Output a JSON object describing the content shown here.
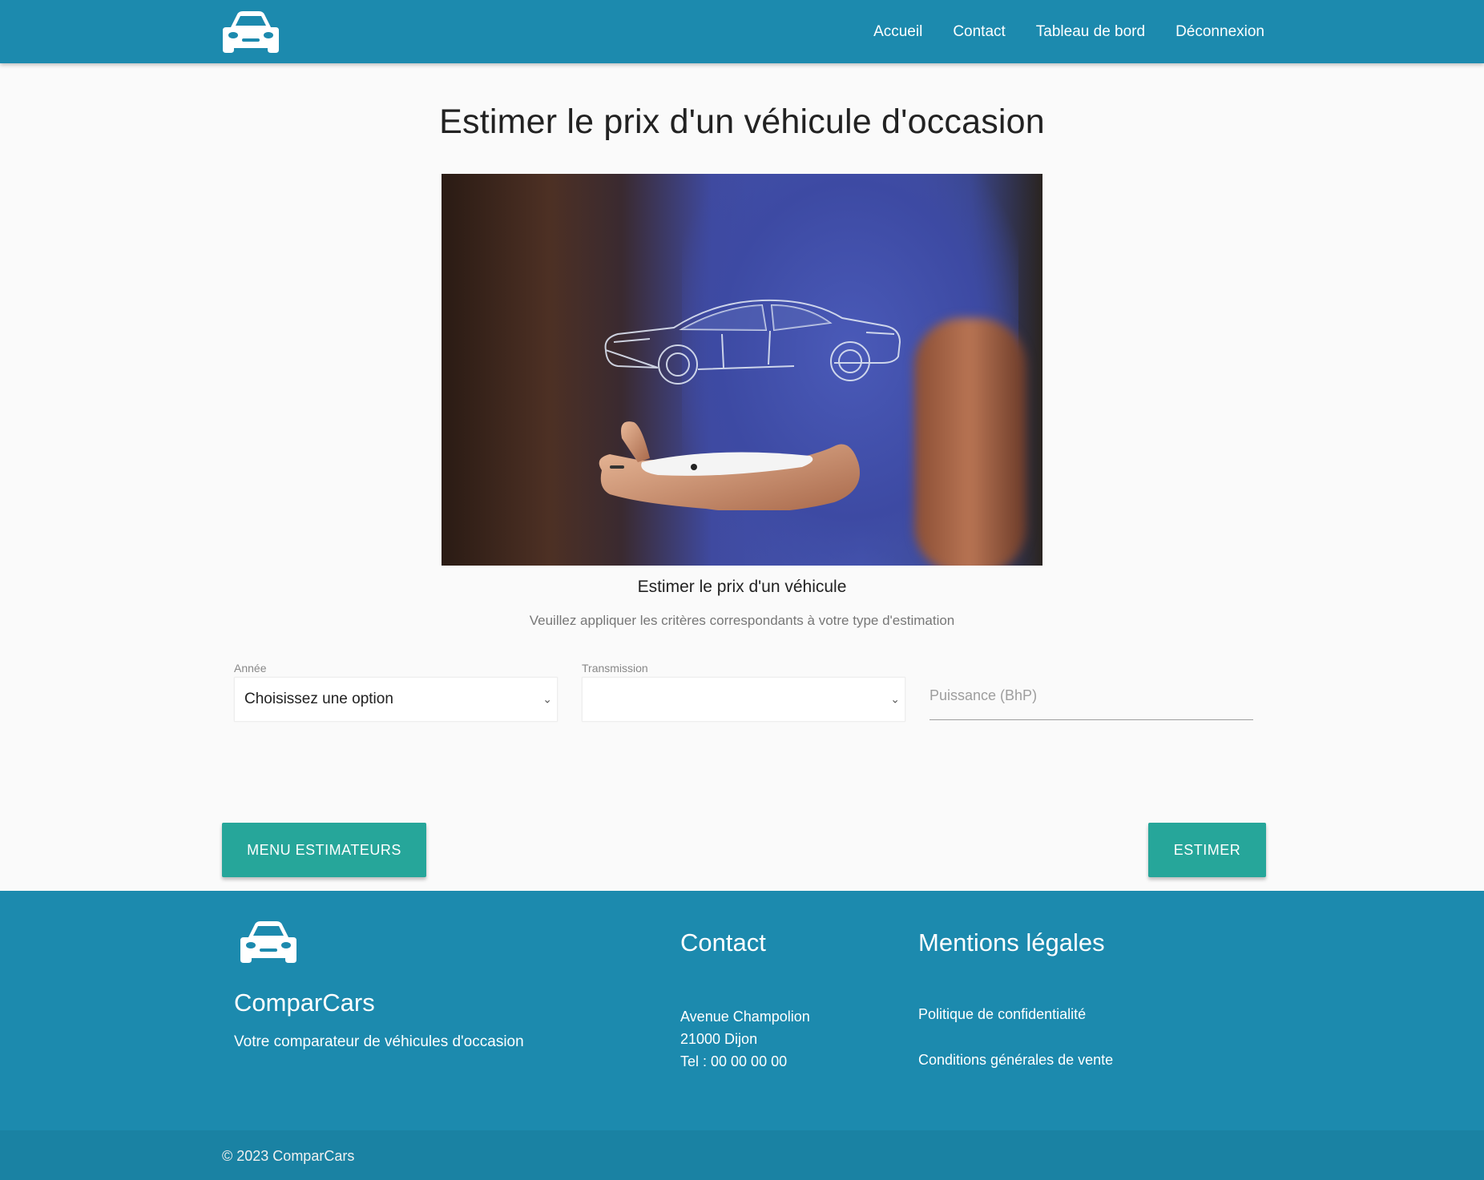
{
  "nav": {
    "logo_icon": "car-icon",
    "links": [
      "Accueil",
      "Contact",
      "Tableau de bord",
      "Déconnexion"
    ]
  },
  "main": {
    "title": "Estimer le prix d'un véhicule d'occasion",
    "card_title": "Estimer le prix d'un véhicule",
    "card_subtitle": "Veuillez appliquer les critères correspondants à votre type d'estimation",
    "form": {
      "year_label": "Année",
      "year_value": "Choisissez une option",
      "transmission_label": "Transmission",
      "transmission_value": "",
      "power_placeholder": "Puissance (BhP)"
    },
    "buttons": {
      "menu": "MENU ESTIMATEURS",
      "estimate": "ESTIMER"
    }
  },
  "footer": {
    "brand": "ComparCars",
    "tagline": "Votre comparateur de véhicules d'occasion",
    "contact_title": "Contact",
    "address_line1": "Avenue Champolion",
    "address_line2": "21000 Dijon",
    "phone": "Tel : 00 00 00 00",
    "legal_title": "Mentions légales",
    "privacy": "Politique de confidentialité",
    "terms": "Conditions générales de vente",
    "copyright": "© 2023 ComparCars"
  },
  "colors": {
    "primary": "#1c8aae",
    "accent": "#26a69a",
    "background": "#fafafa"
  }
}
